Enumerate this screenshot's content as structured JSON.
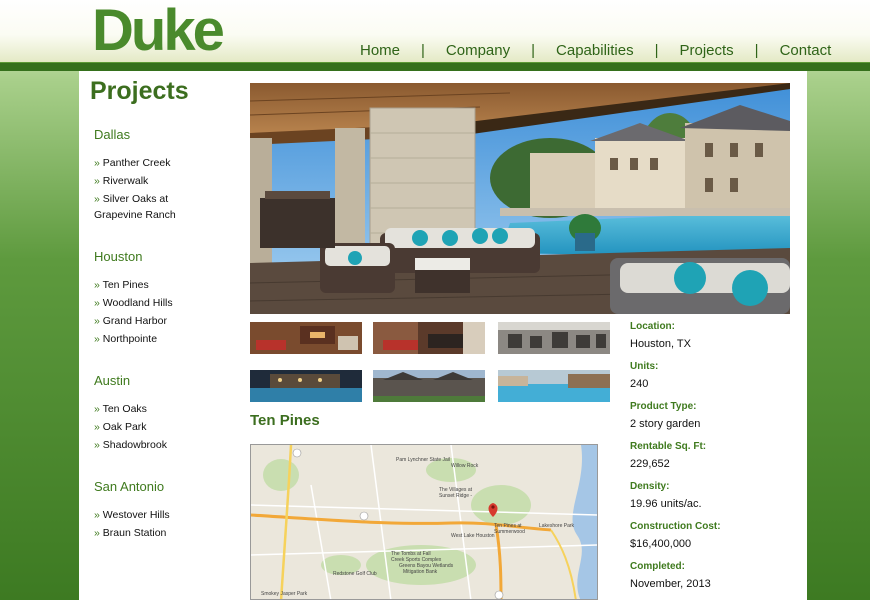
{
  "header": {
    "logo_text": "Duke",
    "nav": [
      "Home",
      "|",
      "Company",
      "|",
      "Capabilities",
      "|",
      "Projects",
      "|",
      "Contact"
    ]
  },
  "page_title": "Projects",
  "sidebar": {
    "groups": [
      {
        "city": "Dallas",
        "projects": [
          "Panther Creek",
          "Riverwalk",
          "Silver Oaks at",
          "Grapevine Ranch"
        ]
      },
      {
        "city": "Houston",
        "projects": [
          "Ten Pines",
          "Woodland Hills",
          "Grand Harbor",
          "Northpointe"
        ]
      },
      {
        "city": "Austin",
        "projects": [
          "Ten Oaks",
          "Oak Park",
          "Shadowbrook"
        ]
      },
      {
        "city": "San Antonio",
        "projects": [
          "Westover Hills",
          "Braun Station"
        ]
      }
    ]
  },
  "project": {
    "name": "Ten Pines",
    "details": [
      {
        "label": "Location:",
        "value": "Houston, TX"
      },
      {
        "label": "Units:",
        "value": "240"
      },
      {
        "label": "Product Type:",
        "value": "2 story garden"
      },
      {
        "label": "Rentable Sq. Ft:",
        "value": "229,652"
      },
      {
        "label": "Density:",
        "value": "19.96 units/ac."
      },
      {
        "label": "Construction Cost:",
        "value": "$16,400,000"
      },
      {
        "label": "Completed:",
        "value": "November, 2013"
      }
    ]
  },
  "map": {
    "labels": {
      "lake_jail": "Pam Lynchner State Jail",
      "villages": "The Villages at",
      "villages2": "Sunset Ridge -",
      "pin": "Ten Pines at",
      "pin2": "Summerwood",
      "lakeshore": "Lakeshore Park",
      "tombs": "The Tombs at Fall",
      "creek": "Creek Sports Complex",
      "greens": "Greens Bayou Wetlands",
      "mitigation": "Mitigation Bank",
      "golf": "Redstone Golf Club",
      "smokey": "Smokey Jasper Park",
      "willow": "Willow Rock",
      "west_lake": "West Lake Houston"
    }
  },
  "colors": {
    "brand_green": "#4a8a2c",
    "header_rule": "#35701c",
    "accent_text": "#3f7a1e"
  }
}
